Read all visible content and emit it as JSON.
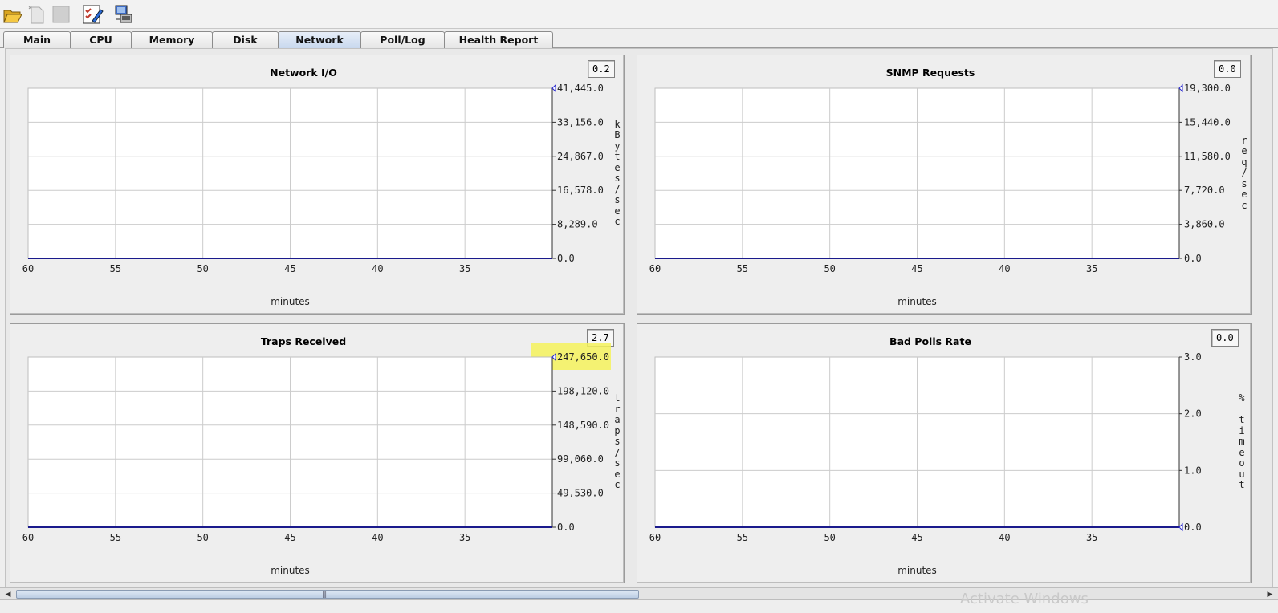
{
  "toolbar": {
    "buttons": [
      {
        "icon": "open-folder-icon"
      },
      {
        "icon": "new-document-icon"
      },
      {
        "icon": "disabled-document-icon"
      },
      {
        "icon": "checklist-edit-icon"
      },
      {
        "icon": "network-computer-icon"
      }
    ]
  },
  "tabs": [
    {
      "label": "Main",
      "active": false
    },
    {
      "label": "CPU",
      "active": false
    },
    {
      "label": "Memory",
      "active": false
    },
    {
      "label": "Disk",
      "active": false
    },
    {
      "label": "Network",
      "active": true
    },
    {
      "label": "Poll/Log",
      "active": false
    },
    {
      "label": "Health Report",
      "active": false
    }
  ],
  "panels": {
    "network_io": {
      "title": "Network I/O",
      "current_value": "0.2",
      "ylabel": "kBytes/sec",
      "highlighted_top": false
    },
    "snmp_requests": {
      "title": "SNMP Requests",
      "current_value": "0.0",
      "ylabel": "req/sec",
      "highlighted_top": false
    },
    "traps_received": {
      "title": "Traps Received",
      "current_value": "2.7",
      "ylabel": "traps/sec",
      "highlighted_top": true
    },
    "bad_polls_rate": {
      "title": "Bad Polls Rate",
      "current_value": "0.0",
      "ylabel": "% timeout",
      "highlighted_top": false
    }
  },
  "chart_data": [
    {
      "type": "line",
      "title": "Network I/O",
      "xlabel": "minutes",
      "ylabel": "kBytes/sec",
      "x_ticks": [
        "60",
        "55",
        "50",
        "45",
        "40",
        "35"
      ],
      "xlim": [
        60,
        30
      ],
      "y_ticks": [
        "0.0",
        "8,289.0",
        "16,578.0",
        "24,867.0",
        "33,156.0",
        "41,445.0"
      ],
      "ylim": [
        0,
        41445
      ],
      "grid": true,
      "series": [
        {
          "x": [
            60,
            30
          ],
          "values": [
            0,
            0
          ]
        }
      ],
      "marker_value": 41445
    },
    {
      "type": "line",
      "title": "SNMP Requests",
      "xlabel": "minutes",
      "ylabel": "req/sec",
      "x_ticks": [
        "60",
        "55",
        "50",
        "45",
        "40",
        "35"
      ],
      "xlim": [
        60,
        30
      ],
      "y_ticks": [
        "0.0",
        "3,860.0",
        "7,720.0",
        "11,580.0",
        "15,440.0",
        "19,300.0"
      ],
      "ylim": [
        0,
        19300
      ],
      "grid": true,
      "series": [
        {
          "x": [
            60,
            30
          ],
          "values": [
            0,
            0
          ]
        }
      ],
      "marker_value": 19300
    },
    {
      "type": "line",
      "title": "Traps Received",
      "xlabel": "minutes",
      "ylabel": "traps/sec",
      "x_ticks": [
        "60",
        "55",
        "50",
        "45",
        "40",
        "35"
      ],
      "xlim": [
        60,
        30
      ],
      "y_ticks": [
        "0.0",
        "49,530.0",
        "99,060.0",
        "148,590.0",
        "198,120.0",
        "247,650.0"
      ],
      "ylim": [
        0,
        247650
      ],
      "grid": true,
      "series": [
        {
          "x": [
            60,
            30
          ],
          "values": [
            0,
            0
          ]
        }
      ],
      "marker_value": 247650
    },
    {
      "type": "line",
      "title": "Bad Polls Rate",
      "xlabel": "minutes",
      "ylabel": "% timeout",
      "x_ticks": [
        "60",
        "55",
        "50",
        "45",
        "40",
        "35"
      ],
      "xlim": [
        60,
        30
      ],
      "y_ticks": [
        "0.0",
        "1.0",
        "2.0",
        "3.0"
      ],
      "ylim": [
        0,
        3
      ],
      "grid": true,
      "series": [
        {
          "x": [
            60,
            30
          ],
          "values": [
            0,
            0
          ]
        }
      ],
      "marker_value": 0
    }
  ],
  "colors": {
    "series": "#1a1a8c",
    "grid": "#cccccc",
    "highlight": "#f4f25c"
  },
  "watermark": "Activate Windows"
}
